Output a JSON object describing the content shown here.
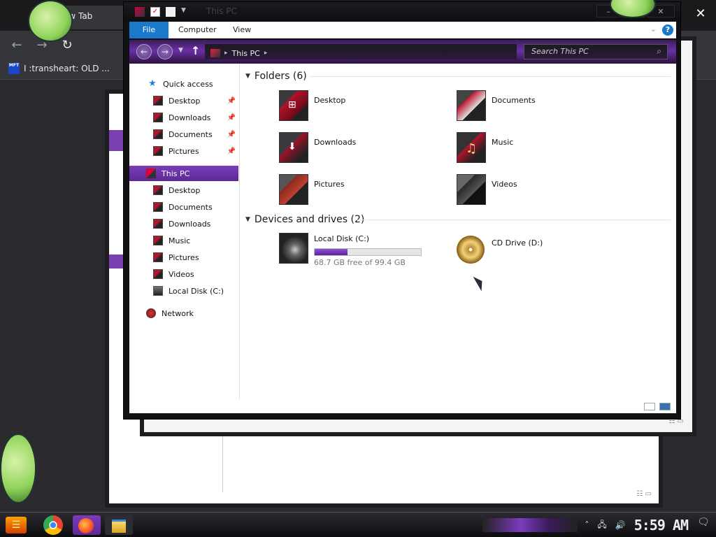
{
  "browser": {
    "tab_title": "New Tab",
    "bookmark": "I :transheart: OLD ...",
    "bookmark_favicon": "MFT",
    "close_symbol": "✕"
  },
  "explorer": {
    "title": "This PC",
    "ribbon_tabs": [
      "File",
      "Computer",
      "View"
    ],
    "address_path": [
      "This PC"
    ],
    "search_placeholder": "Search This PC",
    "nav": {
      "quick_access": "Quick access",
      "quick_items": [
        "Desktop",
        "Downloads",
        "Documents",
        "Pictures"
      ],
      "this_pc": "This PC",
      "pc_items": [
        "Desktop",
        "Documents",
        "Downloads",
        "Music",
        "Pictures",
        "Videos",
        "Local Disk (C:)"
      ],
      "network": "Network"
    },
    "folders_header": "Folders (6)",
    "folders": [
      "Desktop",
      "Documents",
      "Downloads",
      "Music",
      "Pictures",
      "Videos"
    ],
    "devices_header": "Devices and drives (2)",
    "drives": [
      {
        "name": "Local Disk (C:)",
        "free_text": "68.7 GB free of 99.4 GB",
        "used_fraction": 0.309
      },
      {
        "name": "CD Drive (D:)"
      }
    ]
  },
  "taskbar": {
    "clock": "5:59 AM",
    "apps": [
      "chrome-icon",
      "firefox-icon",
      "file-explorer-icon"
    ]
  },
  "colors": {
    "accent_purple": "#6b2fa6",
    "ribbon_file_blue": "#1979ca"
  }
}
